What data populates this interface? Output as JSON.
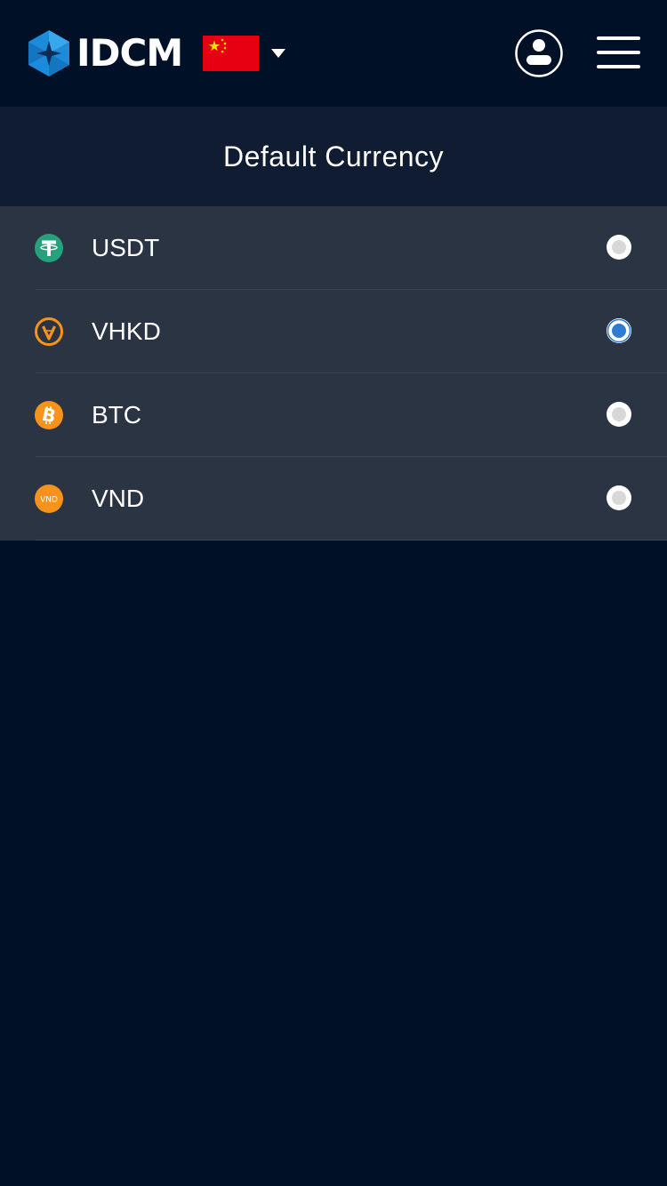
{
  "header": {
    "brand_name": "IDCM",
    "language_flag": "china-flag-icon",
    "account_icon": "user-icon",
    "menu_icon": "hamburger-menu-icon"
  },
  "page": {
    "title": "Default Currency"
  },
  "currencies": [
    {
      "code": "USDT",
      "icon": "usdt-icon",
      "icon_color": "#26a17b",
      "selected": false
    },
    {
      "code": "VHKD",
      "icon": "vhkd-icon",
      "icon_color": "#f7931a",
      "selected": true
    },
    {
      "code": "BTC",
      "icon": "btc-icon",
      "icon_color": "#f7931a",
      "selected": false
    },
    {
      "code": "VND",
      "icon": "vnd-icon",
      "icon_color": "#f7931a",
      "selected": false
    }
  ],
  "colors": {
    "background": "#001027",
    "section_header_bg": "#101c31",
    "list_bg": "#2a3442",
    "radio_selected": "#2f7bd3",
    "radio_unselected": "#d8d8d8",
    "flag_red": "#e60012",
    "flag_star": "#ffde00",
    "brand_blue": "#1b8bdb"
  }
}
